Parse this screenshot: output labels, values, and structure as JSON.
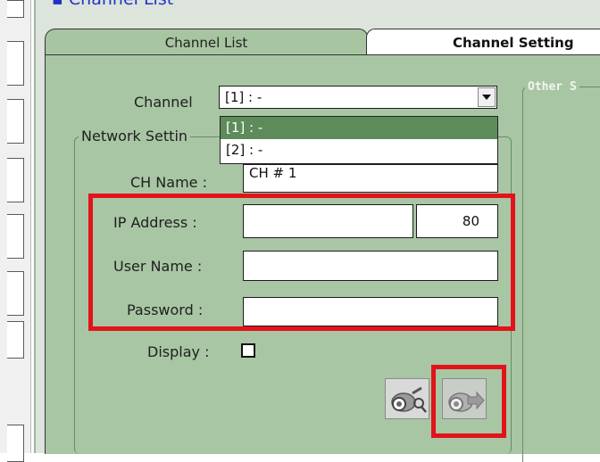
{
  "header": {
    "title": "▪ Channel List"
  },
  "tabs": [
    {
      "label": "Channel List"
    },
    {
      "label": "Channel Setting"
    }
  ],
  "channel": {
    "label": "Channel",
    "selected": "[1] : -",
    "options": [
      "[1] : -",
      "[2] : -"
    ]
  },
  "network": {
    "legend": "Network Settin",
    "ch_name_label": "CH Name :",
    "ch_name_value": "CH # 1",
    "ip_label": "IP Address :",
    "ip_value": "",
    "port_value": "80",
    "user_label": "User Name :",
    "user_value": "",
    "password_label": "Password :",
    "password_value": "",
    "display_label": "Display :"
  },
  "other": {
    "legend": "Other S"
  },
  "colors": {
    "highlight": "#e2131b",
    "panel_bg": "#a8c6a3",
    "selected_option": "#5e8b5a"
  },
  "icons": {
    "search_camera": "camera-search-icon",
    "apply_camera": "camera-arrow-icon"
  }
}
